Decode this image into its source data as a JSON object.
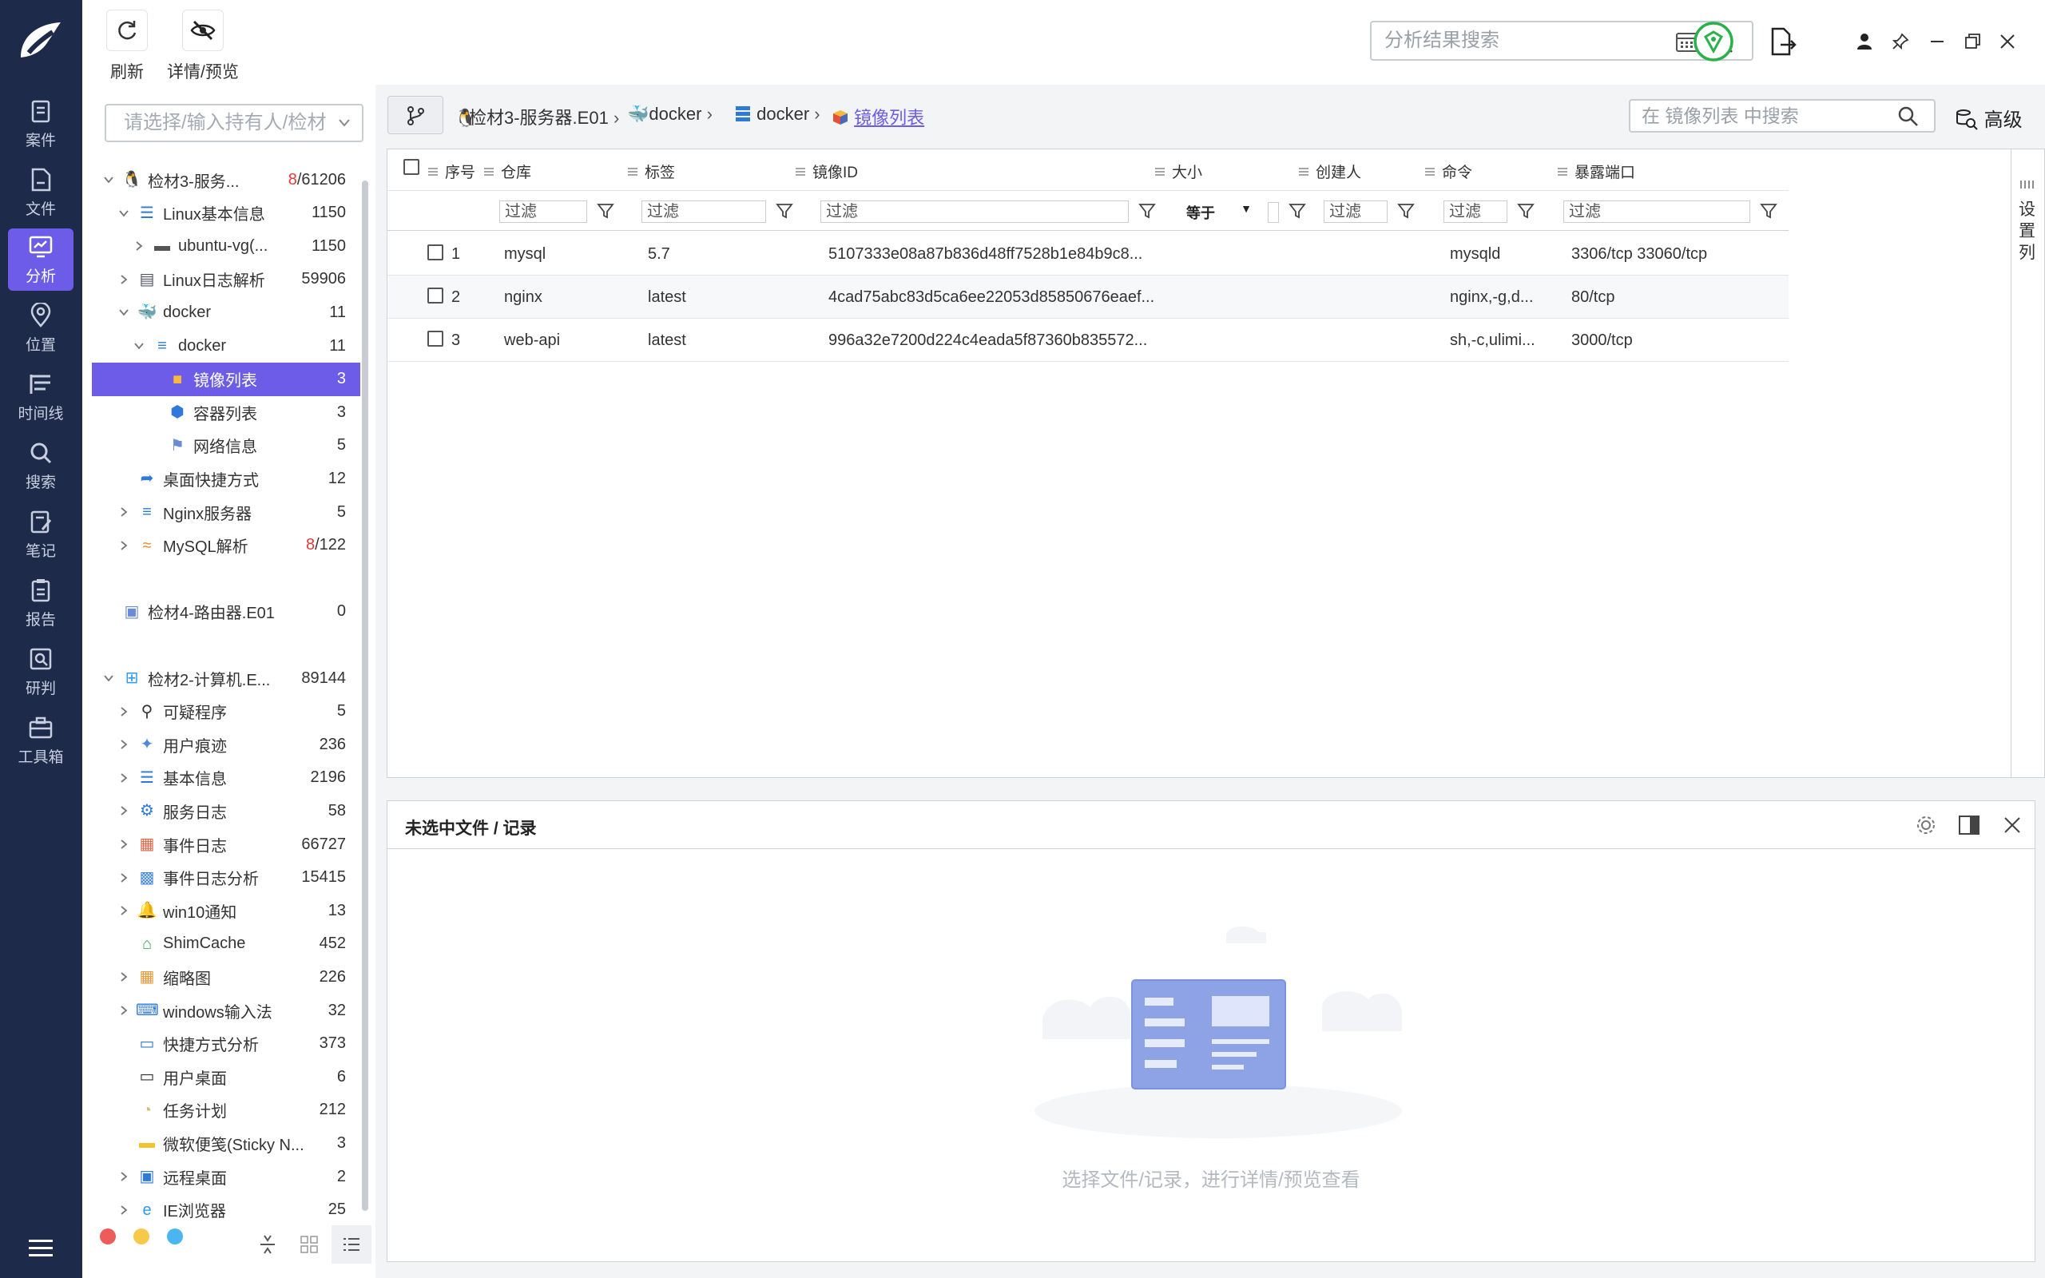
{
  "nav": {
    "items": [
      {
        "label": "案件",
        "icon": "case-icon"
      },
      {
        "label": "文件",
        "icon": "file-icon"
      },
      {
        "label": "分析",
        "icon": "analysis-icon",
        "active": true
      },
      {
        "label": "位置",
        "icon": "location-icon"
      },
      {
        "label": "时间线",
        "icon": "timeline-icon"
      },
      {
        "label": "搜索",
        "icon": "search-icon"
      },
      {
        "label": "笔记",
        "icon": "note-icon"
      },
      {
        "label": "报告",
        "icon": "report-icon"
      },
      {
        "label": "研判",
        "icon": "judge-icon"
      },
      {
        "label": "工具箱",
        "icon": "toolbox-icon"
      }
    ],
    "accent": "#6c5ce7",
    "background": "#1e2a4a"
  },
  "toolbar": {
    "refresh_label": "刷新",
    "detail_label": "详情/预览",
    "search_placeholder": "分析结果搜索"
  },
  "tree": {
    "select_placeholder": "请选择/输入持有人/检材",
    "items": [
      {
        "label": "检材3-服务...",
        "count_a": "8",
        "count_b": "/61206"
      },
      {
        "label": "Linux基本信息",
        "count": "1150"
      },
      {
        "label": "ubuntu-vg(...",
        "count": "1150"
      },
      {
        "label": "Linux日志解析",
        "count": "59906"
      },
      {
        "label": "docker",
        "count": "11"
      },
      {
        "label": "docker",
        "count": "11"
      },
      {
        "label": "镜像列表",
        "count": "3"
      },
      {
        "label": "容器列表",
        "count": "3"
      },
      {
        "label": "网络信息",
        "count": "5"
      },
      {
        "label": "桌面快捷方式",
        "count": "12"
      },
      {
        "label": "Nginx服务器",
        "count": "5"
      },
      {
        "label": "MySQL解析",
        "count_a": "8",
        "count_b": "/122"
      },
      {
        "label": "检材4-路由器.E01",
        "count": "0"
      },
      {
        "label": "检材2-计算机.E...",
        "count": "89144"
      },
      {
        "label": "可疑程序",
        "count": "5"
      },
      {
        "label": "用户痕迹",
        "count": "236"
      },
      {
        "label": "基本信息",
        "count": "2196"
      },
      {
        "label": "服务日志",
        "count": "58"
      },
      {
        "label": "事件日志",
        "count": "66727"
      },
      {
        "label": "事件日志分析",
        "count": "15415"
      },
      {
        "label": "win10通知",
        "count": "13"
      },
      {
        "label": "ShimCache",
        "count": "452"
      },
      {
        "label": "缩略图",
        "count": "226"
      },
      {
        "label": "windows输入法",
        "count": "32"
      },
      {
        "label": "快捷方式分析",
        "count": "373"
      },
      {
        "label": "用户桌面",
        "count": "6"
      },
      {
        "label": "任务计划",
        "count": "212"
      },
      {
        "label": "微软便笺(Sticky N...",
        "count": "3"
      },
      {
        "label": "远程桌面",
        "count": "2"
      },
      {
        "label": "IE浏览器",
        "count": "25"
      }
    ]
  },
  "breadcrumb": {
    "items": [
      "检材3-服务器.E01",
      "docker",
      "docker",
      "镜像列表"
    ],
    "search_placeholder": "在 镜像列表 中搜索",
    "advanced_label": "高级"
  },
  "grid": {
    "columns": [
      "序号",
      "仓库",
      "标签",
      "镜像ID",
      "大小",
      "创建人",
      "命令",
      "暴露端口"
    ],
    "filter_placeholder": "过滤",
    "size_filter_op": "等于",
    "rows": [
      {
        "no": "1",
        "repo": "mysql",
        "tag": "5.7",
        "id": "5107333e08a87b836d48ff7528b1e84b9c8...",
        "size": "",
        "creator": "",
        "cmd": "mysqld",
        "ports": "3306/tcp 33060/tcp"
      },
      {
        "no": "2",
        "repo": "nginx",
        "tag": "latest",
        "id": "4cad75abc83d5ca6ee22053d85850676eaef...",
        "size": "",
        "creator": "",
        "cmd": "nginx,-g,d...",
        "ports": "80/tcp"
      },
      {
        "no": "3",
        "repo": "web-api",
        "tag": "latest",
        "id": "996a32e7200d224c4eada5f87360b835572...",
        "size": "",
        "creator": "",
        "cmd": "sh,-c,ulimi...",
        "ports": "3000/tcp"
      }
    ],
    "set_columns_label": "设置列"
  },
  "detail": {
    "title": "未选中文件 / 记录",
    "empty_text": "选择文件/记录，进行详情/预览查看"
  }
}
